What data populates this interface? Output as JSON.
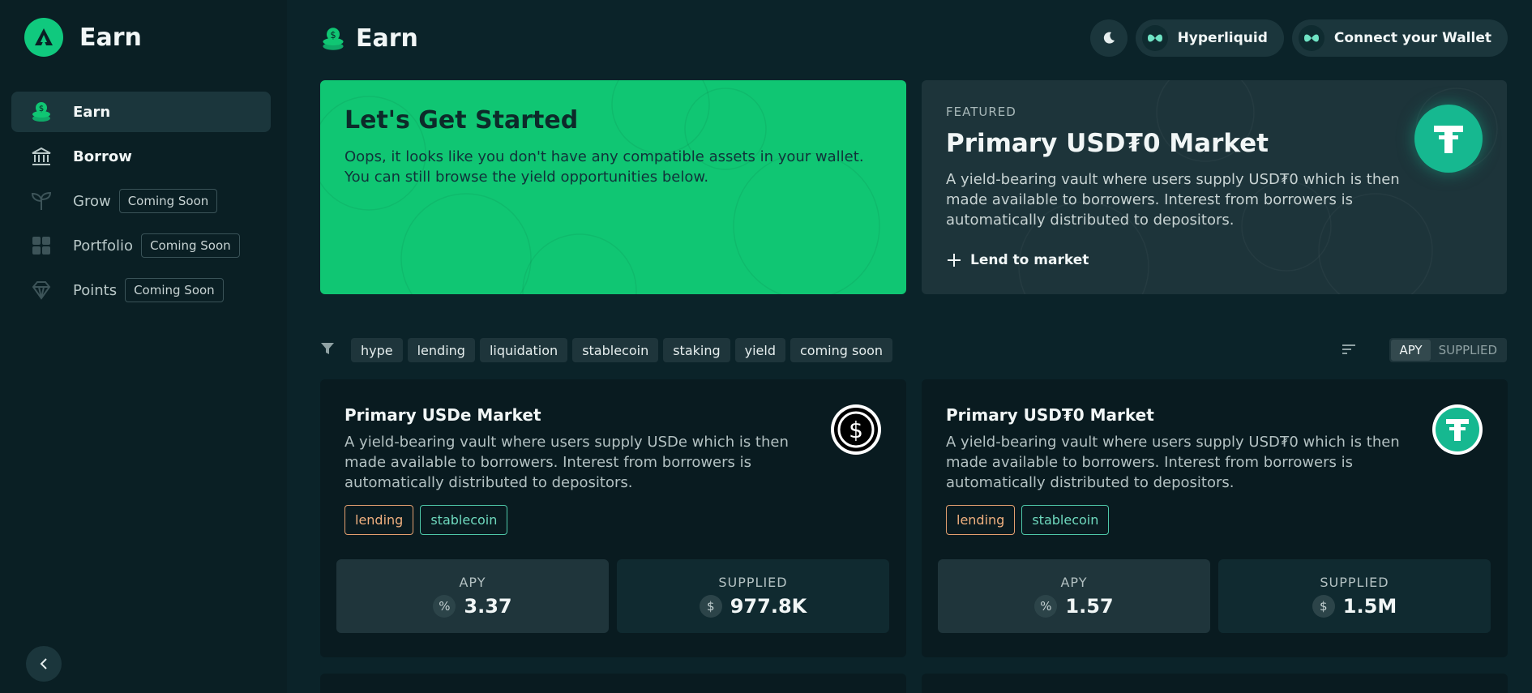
{
  "sidebar": {
    "brand_title": "Earn",
    "items": [
      {
        "label": "Earn",
        "active": true
      },
      {
        "label": "Borrow",
        "active": false
      },
      {
        "label": "Grow",
        "badge": "Coming Soon"
      },
      {
        "label": "Portfolio",
        "badge": "Coming Soon"
      },
      {
        "label": "Points",
        "badge": "Coming Soon"
      }
    ]
  },
  "header": {
    "title": "Earn",
    "network_label": "Hyperliquid",
    "connect_label": "Connect your Wallet"
  },
  "hero": {
    "title": "Let's Get Started",
    "text": "Oops, it looks like you don't have any compatible assets in your wallet. You can still browse the yield opportunities below."
  },
  "featured": {
    "kicker": "FEATURED",
    "title": "Primary USD₮0 Market",
    "text": "A yield-bearing vault where users supply USD₮0 which is then made available to borrowers. Interest from borrowers is automatically distributed to depositors.",
    "action": "Lend to market"
  },
  "filters": {
    "tags": [
      "hype",
      "lending",
      "liquidation",
      "stablecoin",
      "staking",
      "yield",
      "coming soon"
    ],
    "sort_options": [
      "APY",
      "SUPPLIED"
    ],
    "sort_active": "APY"
  },
  "markets": [
    {
      "title": "Primary USDe Market",
      "text": "A yield-bearing vault where users supply USDe which is then made available to borrowers. Interest from borrowers is automatically distributed to depositors.",
      "chips": [
        "lending",
        "stablecoin"
      ],
      "apy_label": "APY",
      "apy_symbol": "%",
      "apy_value": "3.37",
      "supplied_label": "SUPPLIED",
      "supplied_symbol": "$",
      "supplied_value": "977.8K"
    },
    {
      "title": "Primary USD₮0 Market",
      "text": "A yield-bearing vault where users supply USD₮0 which is then made available to borrowers. Interest from borrowers is automatically distributed to depositors.",
      "chips": [
        "lending",
        "stablecoin"
      ],
      "apy_label": "APY",
      "apy_symbol": "%",
      "apy_value": "1.57",
      "supplied_label": "SUPPLIED",
      "supplied_symbol": "$",
      "supplied_value": "1.5M"
    }
  ],
  "colors": {
    "accent": "#10c673",
    "background": "#0b2329",
    "sidebar": "#0a1f24",
    "card": "#091b20",
    "tether": "#16b890"
  }
}
